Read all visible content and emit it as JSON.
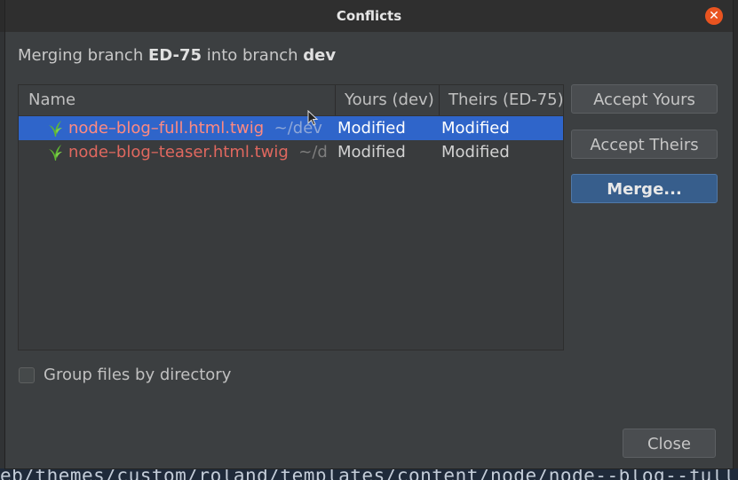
{
  "dialog": {
    "title": "Conflicts",
    "subtitle": {
      "prefix": "Merging branch ",
      "source_branch": "ED-75",
      "middle": " into branch ",
      "target_branch": "dev"
    }
  },
  "table": {
    "columns": [
      "Name",
      "Yours (dev)",
      "Theirs (ED-75)"
    ],
    "rows": [
      {
        "name": "node–blog–full.html.twig",
        "path": "~/dev",
        "yours": "Modified",
        "theirs": "Modified",
        "selected": true
      },
      {
        "name": "node–blog–teaser.html.twig",
        "path": "~/d",
        "yours": "Modified",
        "theirs": "Modified",
        "selected": false
      }
    ]
  },
  "buttons": {
    "accept_yours": "Accept Yours",
    "accept_theirs": "Accept Theirs",
    "merge": "Merge...",
    "close": "Close"
  },
  "options": {
    "group_by_directory": {
      "label": "Group files by directory",
      "checked": false
    }
  },
  "background": {
    "code_text": "eb/themes/custom/roland/templates/content/node/node--blog--full.html"
  },
  "colors": {
    "accent": "#2f65ca",
    "conflict_file": "#e0685f",
    "close_icon": "#e95420",
    "file_icon": "#5fb832"
  },
  "icons": {
    "close": "close-icon",
    "file": "twig-file-icon"
  }
}
